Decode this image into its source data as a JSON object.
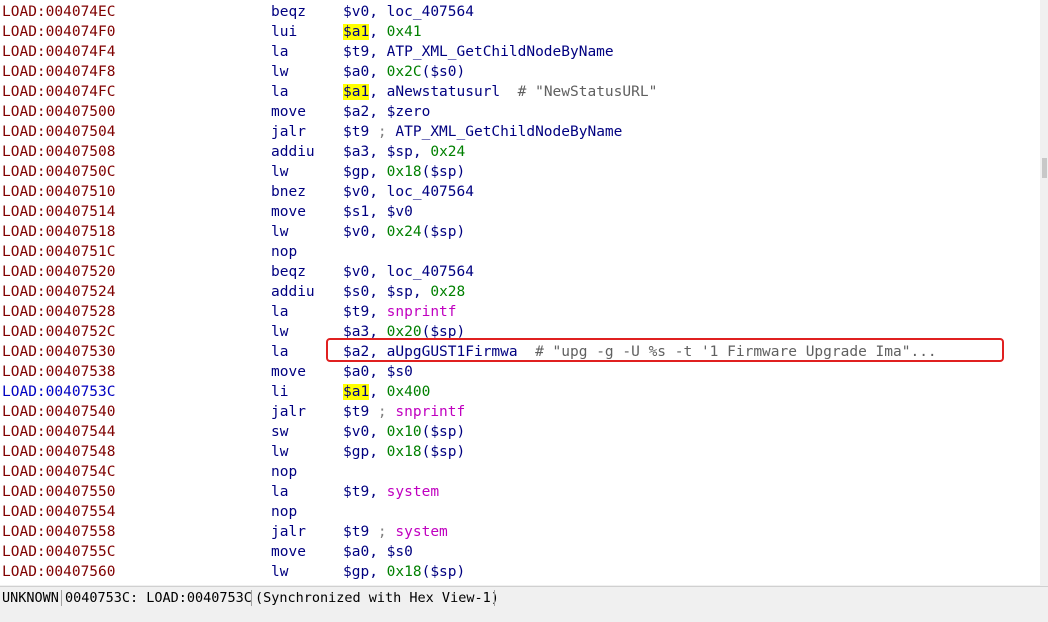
{
  "lines": [
    {
      "addr": "LOAD:004074EC",
      "mn": "beqz",
      "ops": [
        {
          "t": "$v0",
          "k": "reg"
        },
        {
          "t": ", ",
          "k": "p"
        },
        {
          "t": "loc_407564",
          "k": "sym"
        }
      ]
    },
    {
      "addr": "LOAD:004074F0",
      "mn": "lui",
      "ops": [
        {
          "t": "$a1",
          "k": "regh"
        },
        {
          "t": ", ",
          "k": "p"
        },
        {
          "t": "0x41",
          "k": "num"
        }
      ]
    },
    {
      "addr": "LOAD:004074F4",
      "mn": "la",
      "ops": [
        {
          "t": "$t9",
          "k": "reg"
        },
        {
          "t": ", ",
          "k": "p"
        },
        {
          "t": "ATP_XML_GetChildNodeByName",
          "k": "sym"
        }
      ]
    },
    {
      "addr": "LOAD:004074F8",
      "mn": "lw",
      "ops": [
        {
          "t": "$a0",
          "k": "reg"
        },
        {
          "t": ", ",
          "k": "p"
        },
        {
          "t": "0x2C",
          "k": "num"
        },
        {
          "t": "($s0)",
          "k": "reg"
        }
      ]
    },
    {
      "addr": "LOAD:004074FC",
      "mn": "la",
      "ops": [
        {
          "t": "$a1",
          "k": "regh"
        },
        {
          "t": ", ",
          "k": "p"
        },
        {
          "t": "aNewstatusurl",
          "k": "sym"
        },
        {
          "t": "  # \"NewStatusURL\"",
          "k": "cmt"
        }
      ]
    },
    {
      "addr": "LOAD:00407500",
      "mn": "move",
      "ops": [
        {
          "t": "$a2",
          "k": "reg"
        },
        {
          "t": ", ",
          "k": "p"
        },
        {
          "t": "$zero",
          "k": "reg"
        }
      ]
    },
    {
      "addr": "LOAD:00407504",
      "mn": "jalr",
      "ops": [
        {
          "t": "$t9",
          "k": "reg"
        },
        {
          "t": " ; ",
          "k": "semi"
        },
        {
          "t": "ATP_XML_GetChildNodeByName",
          "k": "sym"
        }
      ]
    },
    {
      "addr": "LOAD:00407508",
      "mn": "addiu",
      "ops": [
        {
          "t": "$a3",
          "k": "reg"
        },
        {
          "t": ", ",
          "k": "p"
        },
        {
          "t": "$sp",
          "k": "reg"
        },
        {
          "t": ", ",
          "k": "p"
        },
        {
          "t": "0x24",
          "k": "num"
        }
      ]
    },
    {
      "addr": "LOAD:0040750C",
      "mn": "lw",
      "ops": [
        {
          "t": "$gp",
          "k": "reg"
        },
        {
          "t": ", ",
          "k": "p"
        },
        {
          "t": "0x18",
          "k": "num"
        },
        {
          "t": "($sp)",
          "k": "reg"
        }
      ]
    },
    {
      "addr": "LOAD:00407510",
      "mn": "bnez",
      "ops": [
        {
          "t": "$v0",
          "k": "reg"
        },
        {
          "t": ", ",
          "k": "p"
        },
        {
          "t": "loc_407564",
          "k": "sym"
        }
      ]
    },
    {
      "addr": "LOAD:00407514",
      "mn": "move",
      "ops": [
        {
          "t": "$s1",
          "k": "reg"
        },
        {
          "t": ", ",
          "k": "p"
        },
        {
          "t": "$v0",
          "k": "reg"
        }
      ]
    },
    {
      "addr": "LOAD:00407518",
      "mn": "lw",
      "ops": [
        {
          "t": "$v0",
          "k": "reg"
        },
        {
          "t": ", ",
          "k": "p"
        },
        {
          "t": "0x24",
          "k": "num"
        },
        {
          "t": "($sp)",
          "k": "reg"
        }
      ]
    },
    {
      "addr": "LOAD:0040751C",
      "mn": "nop",
      "ops": []
    },
    {
      "addr": "LOAD:00407520",
      "mn": "beqz",
      "ops": [
        {
          "t": "$v0",
          "k": "reg"
        },
        {
          "t": ", ",
          "k": "p"
        },
        {
          "t": "loc_407564",
          "k": "sym"
        }
      ]
    },
    {
      "addr": "LOAD:00407524",
      "mn": "addiu",
      "ops": [
        {
          "t": "$s0",
          "k": "reg"
        },
        {
          "t": ", ",
          "k": "p"
        },
        {
          "t": "$sp",
          "k": "reg"
        },
        {
          "t": ", ",
          "k": "p"
        },
        {
          "t": "0x28",
          "k": "num"
        }
      ]
    },
    {
      "addr": "LOAD:00407528",
      "mn": "la",
      "ops": [
        {
          "t": "$t9",
          "k": "reg"
        },
        {
          "t": ", ",
          "k": "p"
        },
        {
          "t": "snprintf",
          "k": "call"
        }
      ]
    },
    {
      "addr": "LOAD:0040752C",
      "mn": "lw",
      "ops": [
        {
          "t": "$a3",
          "k": "reg"
        },
        {
          "t": ", ",
          "k": "p"
        },
        {
          "t": "0x20",
          "k": "num"
        },
        {
          "t": "($sp)",
          "k": "reg"
        }
      ]
    },
    {
      "addr": "LOAD:00407530",
      "mn": "la",
      "ops": [
        {
          "t": "$a2",
          "k": "reg"
        },
        {
          "t": ", ",
          "k": "p"
        },
        {
          "t": "aUpgGUST1Firmwa",
          "k": "sym"
        },
        {
          "t": "  # \"upg -g -U %s -t '1 Firmware Upgrade Ima\"...",
          "k": "cmt"
        }
      ]
    },
    {
      "addr": "LOAD:00407538",
      "mn": "move",
      "ops": [
        {
          "t": "$a0",
          "k": "reg"
        },
        {
          "t": ", ",
          "k": "p"
        },
        {
          "t": "$s0",
          "k": "reg"
        }
      ]
    },
    {
      "addr": "LOAD:0040753C",
      "mn": "li",
      "hl": true,
      "ops": [
        {
          "t": "$a1",
          "k": "regh"
        },
        {
          "t": ", ",
          "k": "p"
        },
        {
          "t": "0x400",
          "k": "num"
        }
      ]
    },
    {
      "addr": "LOAD:00407540",
      "mn": "jalr",
      "ops": [
        {
          "t": "$t9",
          "k": "reg"
        },
        {
          "t": " ; ",
          "k": "semi"
        },
        {
          "t": "snprintf",
          "k": "call"
        }
      ]
    },
    {
      "addr": "LOAD:00407544",
      "mn": "sw",
      "ops": [
        {
          "t": "$v0",
          "k": "reg"
        },
        {
          "t": ", ",
          "k": "p"
        },
        {
          "t": "0x10",
          "k": "num"
        },
        {
          "t": "($sp)",
          "k": "reg"
        }
      ]
    },
    {
      "addr": "LOAD:00407548",
      "mn": "lw",
      "ops": [
        {
          "t": "$gp",
          "k": "reg"
        },
        {
          "t": ", ",
          "k": "p"
        },
        {
          "t": "0x18",
          "k": "num"
        },
        {
          "t": "($sp)",
          "k": "reg"
        }
      ]
    },
    {
      "addr": "LOAD:0040754C",
      "mn": "nop",
      "ops": []
    },
    {
      "addr": "LOAD:00407550",
      "mn": "la",
      "ops": [
        {
          "t": "$t9",
          "k": "reg"
        },
        {
          "t": ", ",
          "k": "p"
        },
        {
          "t": "system",
          "k": "call"
        }
      ]
    },
    {
      "addr": "LOAD:00407554",
      "mn": "nop",
      "ops": []
    },
    {
      "addr": "LOAD:00407558",
      "mn": "jalr",
      "ops": [
        {
          "t": "$t9",
          "k": "reg"
        },
        {
          "t": " ; ",
          "k": "semi"
        },
        {
          "t": "system",
          "k": "call"
        }
      ]
    },
    {
      "addr": "LOAD:0040755C",
      "mn": "move",
      "ops": [
        {
          "t": "$a0",
          "k": "reg"
        },
        {
          "t": ", ",
          "k": "p"
        },
        {
          "t": "$s0",
          "k": "reg"
        }
      ]
    },
    {
      "addr": "LOAD:00407560",
      "mn": "lw",
      "ops": [
        {
          "t": "$gp",
          "k": "reg"
        },
        {
          "t": ", ",
          "k": "p"
        },
        {
          "t": "0x18",
          "k": "num"
        },
        {
          "t": "($sp)",
          "k": "reg"
        }
      ]
    }
  ],
  "status": {
    "mode": "UNKNOWN",
    "location": "0040753C: LOAD:0040753C",
    "sync": "(Synchronized with Hex View-1)"
  },
  "colors": {
    "address": "#800000",
    "current_address": "#0000c0",
    "highlight": "#ffff00",
    "annotation_box": "#e02020"
  }
}
